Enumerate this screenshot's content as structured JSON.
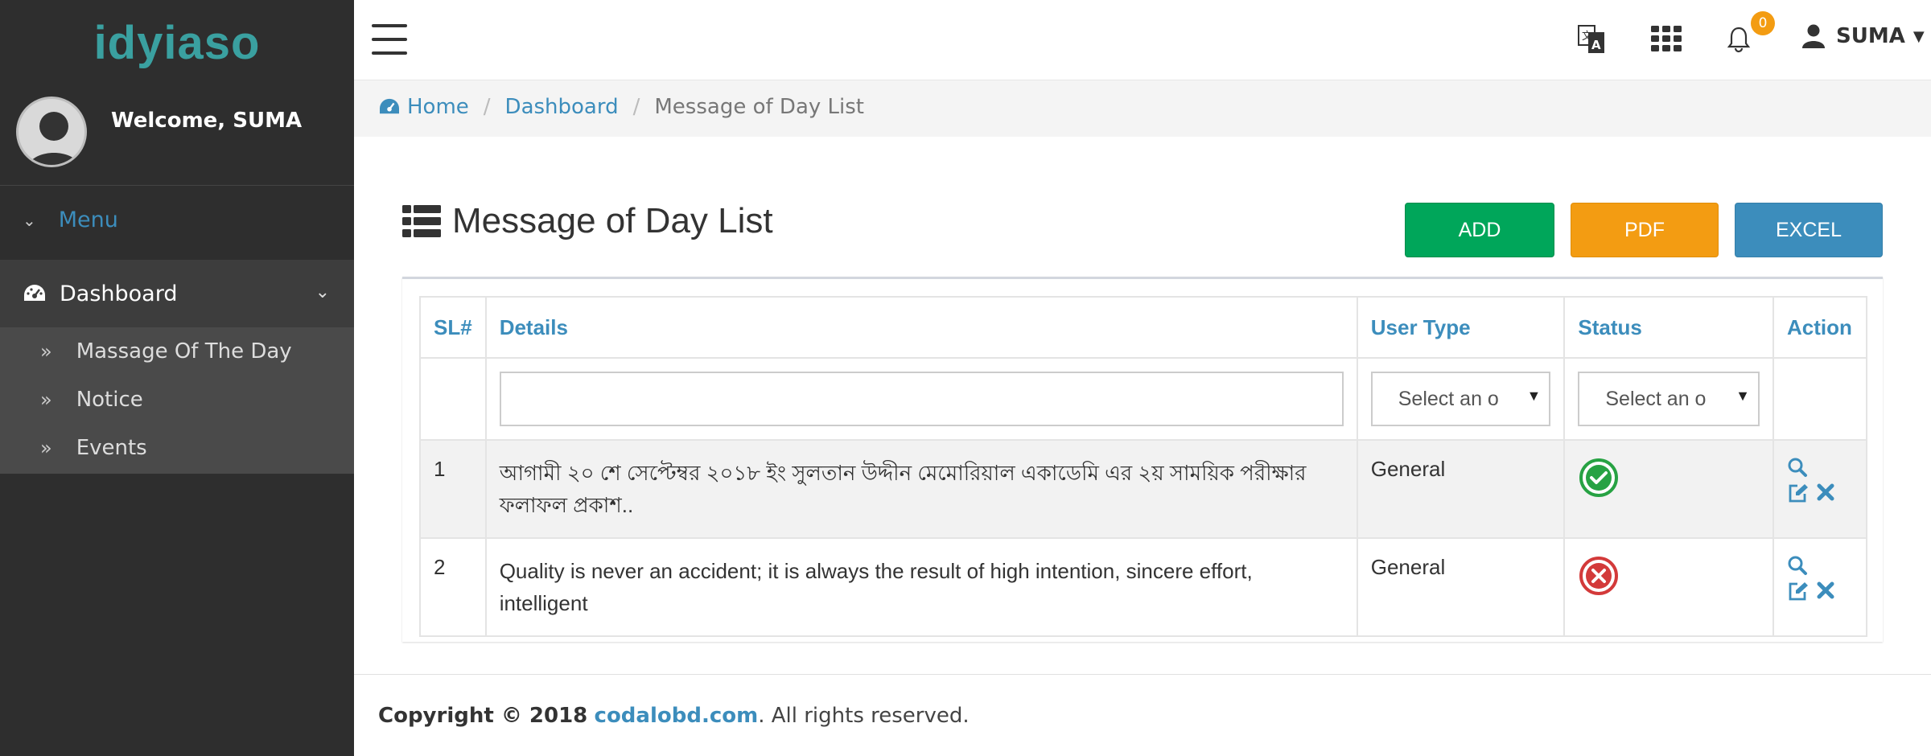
{
  "brand": {
    "logo_text": "idyiaso"
  },
  "user": {
    "welcome": "Welcome, SUMA",
    "name": "SUMA"
  },
  "sidebar": {
    "menu_label": "Menu",
    "dashboard_label": "Dashboard",
    "items": [
      {
        "label": "Massage Of The Day"
      },
      {
        "label": "Notice"
      },
      {
        "label": "Events"
      }
    ]
  },
  "topbar": {
    "notifications_count": "0"
  },
  "breadcrumb": {
    "home": "Home",
    "dashboard": "Dashboard",
    "current": "Message of Day List"
  },
  "page": {
    "title": "Message of Day List"
  },
  "buttons": {
    "add": "ADD",
    "pdf": "PDF",
    "excel": "EXCEL"
  },
  "table": {
    "headers": {
      "sl": "SL#",
      "details": "Details",
      "user_type": "User Type",
      "status": "Status",
      "action": "Action"
    },
    "filters": {
      "user_type_placeholder": "Select an o",
      "status_placeholder": "Select an o"
    },
    "rows": [
      {
        "sl": "1",
        "details": "আগামী ২০ শে সেপ্টেম্বর ২০১৮ ইং সুলতান উদ্দীন মেমোরিয়াল একাডেমি এর ২য় সাময়িক পরীক্ষার ফলাফল প্রকাশ..",
        "user_type": "General",
        "status": "active"
      },
      {
        "sl": "2",
        "details": "Quality is never an accident; it is always the result of high intention, sincere effort, intelligent",
        "user_type": "General",
        "status": "inactive"
      }
    ]
  },
  "footer": {
    "copyright": "Copyright © 2018",
    "link": "codalobd.com",
    "suffix": ". All rights reserved."
  },
  "colors": {
    "primary": "#3c8dbc",
    "success": "#00a65a",
    "warning": "#f39c12",
    "danger": "#dd4b39",
    "sidebar": "#2e2e2e"
  }
}
